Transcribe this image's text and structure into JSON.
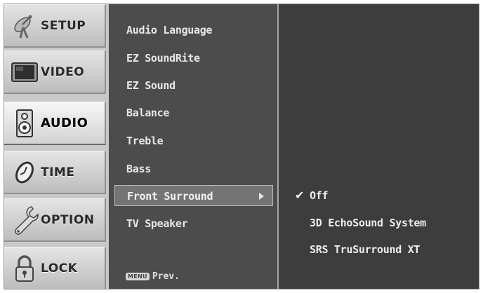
{
  "tabs": [
    {
      "label": "SETUP",
      "icon": "satellite-dish-icon",
      "active": false
    },
    {
      "label": "VIDEO",
      "icon": "tv-screen-icon",
      "active": false
    },
    {
      "label": "AUDIO",
      "icon": "speaker-icon",
      "active": true
    },
    {
      "label": "TIME",
      "icon": "clock-icon",
      "active": false
    },
    {
      "label": "OPTION",
      "icon": "wrench-icon",
      "active": false
    },
    {
      "label": "LOCK",
      "icon": "padlock-icon",
      "active": false
    }
  ],
  "menu": {
    "items": [
      {
        "label": "Audio Language"
      },
      {
        "label": "EZ SoundRite"
      },
      {
        "label": "EZ Sound"
      },
      {
        "label": "Balance"
      },
      {
        "label": "Treble"
      },
      {
        "label": "Bass"
      },
      {
        "label": "Front Surround",
        "selected": true
      },
      {
        "label": "TV Speaker"
      }
    ],
    "prev_key": "MENU",
    "prev_label": "Prev."
  },
  "submenu": {
    "options": [
      {
        "label": "Off",
        "checked": true
      },
      {
        "label": "3D EchoSound System",
        "checked": false
      },
      {
        "label": "SRS TruSurround XT",
        "checked": false
      }
    ],
    "check_glyph": "✔"
  },
  "colors": {
    "panel_bg": "#3d3d3d",
    "menu_bg": "#4c4c4c",
    "selected_bg": "#747474",
    "tab_bg": "#d0d0d0",
    "text": "#e7e7e7"
  }
}
